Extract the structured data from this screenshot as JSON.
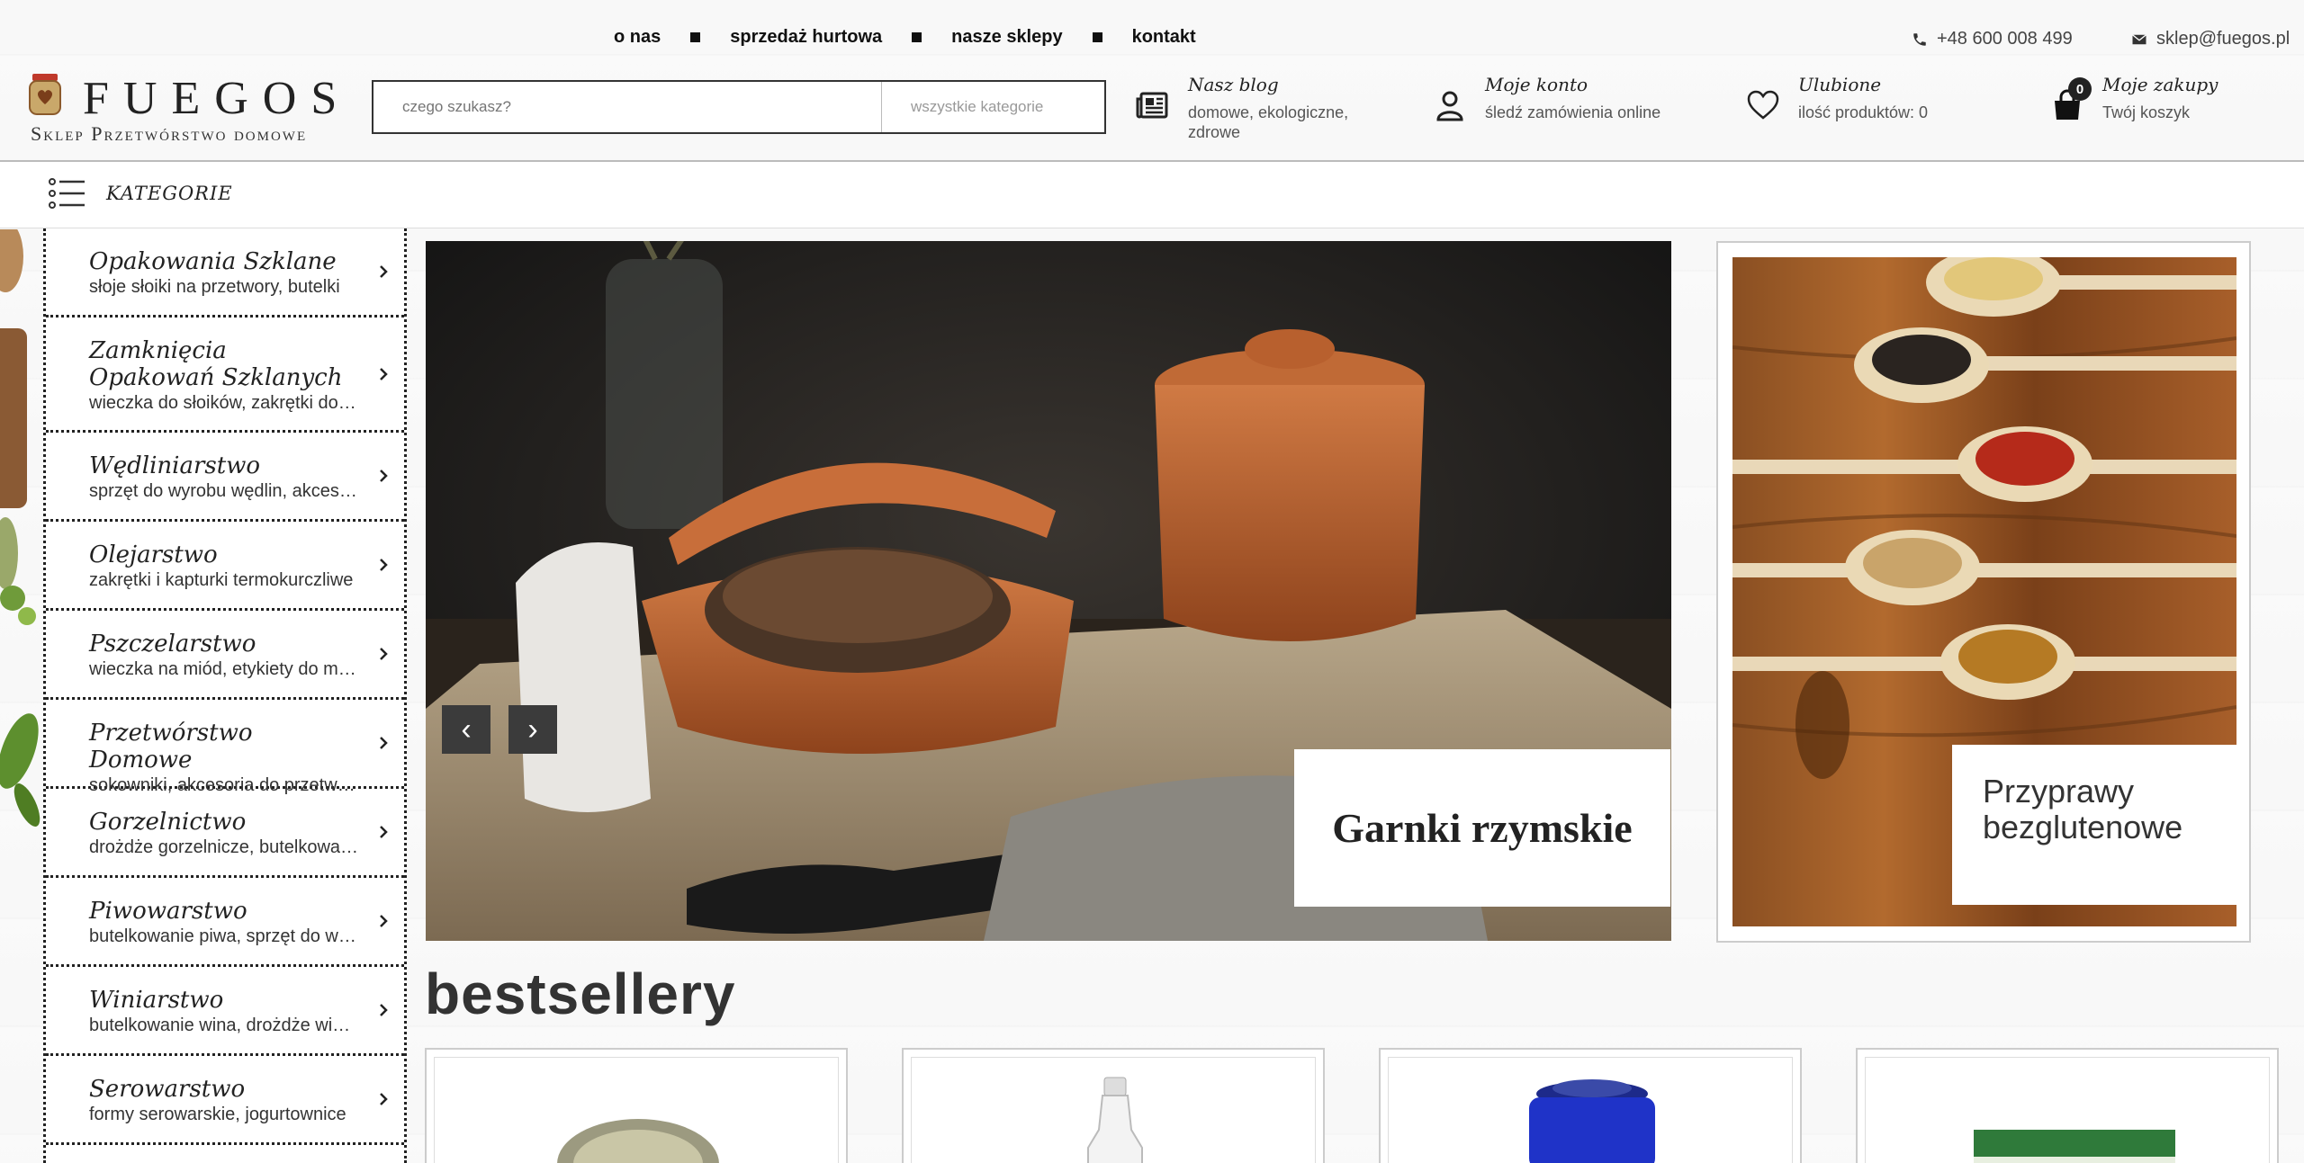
{
  "topnav": {
    "items": [
      "o nas",
      "sprzedaż hurtowa",
      "nasze sklepy",
      "kontakt"
    ]
  },
  "contact": {
    "phone": "+48 600 008 499",
    "email": "sklep@fuegos.pl",
    "phone_icon": "phone-icon",
    "email_icon": "envelope-icon"
  },
  "logo": {
    "brand": "FUEGOS",
    "tagline": "Sklep Przetwórstwo domowe"
  },
  "search": {
    "placeholder": "czego szukasz?",
    "category": "wszystkie kategorie"
  },
  "header": {
    "blog": {
      "title": "Nasz blog",
      "subtitle": "domowe, ekologiczne, zdrowe",
      "icon": "newspaper-icon"
    },
    "account": {
      "title": "Moje konto",
      "subtitle": "śledź zamówienia online",
      "icon": "user-icon"
    },
    "favorites": {
      "title": "Ulubione",
      "subtitle": "ilość produktów: 0",
      "icon": "heart-icon"
    },
    "cart": {
      "title": "Moje zakupy",
      "subtitle": "Twój koszyk",
      "count": "0",
      "icon": "shopping-bag-icon"
    }
  },
  "categories_label": "KATEGORIE",
  "sidebar": {
    "items": [
      {
        "name": "Opakowania Szklane",
        "desc": "słoje słoiki na przetwory, butelki"
      },
      {
        "name": "Zamknięcia Opakowań Szklanych",
        "desc": "wieczka do słoików, zakrętki do butelek"
      },
      {
        "name": "Wędliniarstwo",
        "desc": "sprzęt do wyrobu wędlin, akcesoria"
      },
      {
        "name": "Olejarstwo",
        "desc": "zakrętki i kapturki termokurczliwe"
      },
      {
        "name": "Pszczelarstwo",
        "desc": "wieczka na miód, etykiety do miodu"
      },
      {
        "name": "Przetwórstwo Domowe",
        "desc": "sokowniki, akcesoria do przetworów"
      },
      {
        "name": "Gorzelnictwo",
        "desc": "drożdże gorzelnicze, butelkowanie"
      },
      {
        "name": "Piwowarstwo",
        "desc": "butelkowanie piwa, sprzęt do warzenia"
      },
      {
        "name": "Winiarstwo",
        "desc": "butelkowanie wina, drożdże winiarskie"
      },
      {
        "name": "Serowarstwo",
        "desc": "formy serowarskie, jogurtownice"
      }
    ]
  },
  "hero": {
    "caption": "Garnki rzymskie",
    "prev": "‹",
    "next": "›"
  },
  "banner": {
    "caption": "Przyprawy bezglutenowe"
  },
  "bestsellers": {
    "title": "bestsellery"
  }
}
